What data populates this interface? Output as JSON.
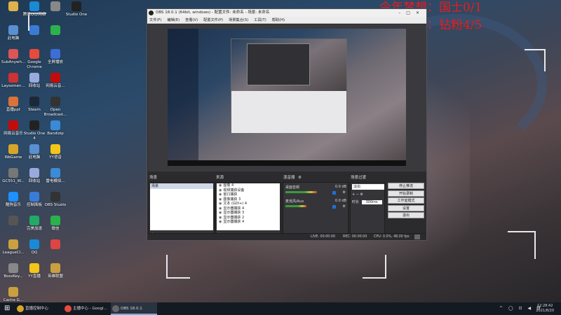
{
  "overlay": {
    "line1": "今年梦想：国士0/1",
    "line2": "今日梦想：钻粉4/5",
    "accent_color": "#e81c1c"
  },
  "desktop_icons": [
    {
      "label": "",
      "icon": "app-icon",
      "color": "#e0b24a"
    },
    {
      "label": "腾讯QQ/网络",
      "icon": "qq-icon",
      "color": "#1a8ad6"
    },
    {
      "label": "",
      "icon": "app-icon",
      "color": "#888"
    },
    {
      "label": "Studio One",
      "icon": "studio-icon",
      "color": "#222"
    },
    {
      "label": "此电脑",
      "icon": "computer-icon",
      "color": "#5a8fd0"
    },
    {
      "label": "",
      "icon": "app-icon",
      "color": "#3a7bd5"
    },
    {
      "label": "",
      "icon": "app-icon",
      "color": "#2bb24c"
    },
    {
      "label": "SubAnywh...",
      "icon": "app-icon",
      "color": "#d55"
    },
    {
      "label": "Google Chrome",
      "icon": "chrome-icon",
      "color": "#e84a3c"
    },
    {
      "label": "全屏播放",
      "icon": "app-icon",
      "color": "#3b6ed6"
    },
    {
      "label": "Laysomen...",
      "icon": "app-icon",
      "color": "#c33"
    },
    {
      "label": "回收站",
      "icon": "recycle-icon",
      "color": "#9ad"
    },
    {
      "label": "网易云音...",
      "icon": "app-icon",
      "color": "#c20c0c"
    },
    {
      "label": "直播ppt",
      "icon": "ppt-icon",
      "color": "#d9733a"
    },
    {
      "label": "Steam",
      "icon": "steam-icon",
      "color": "#1b2838"
    },
    {
      "label": "Open Broadcast...",
      "icon": "obs-icon",
      "color": "#333"
    },
    {
      "label": "网易云音乐",
      "icon": "music-icon",
      "color": "#c20c0c"
    },
    {
      "label": "Studio One 4",
      "icon": "studio-icon",
      "color": "#222"
    },
    {
      "label": "Bandizip",
      "icon": "zip-icon",
      "color": "#3a8ad6"
    },
    {
      "label": "WeGame",
      "icon": "wegame-icon",
      "color": "#d6a52a"
    },
    {
      "label": "此电脑",
      "icon": "computer-icon",
      "color": "#5a8fd0"
    },
    {
      "label": "YY语音",
      "icon": "yy-icon",
      "color": "#f5c518"
    },
    {
      "label": "GC551_W...",
      "icon": "app-icon",
      "color": "#777"
    },
    {
      "label": "回收站",
      "icon": "recycle-icon",
      "color": "#9ad"
    },
    {
      "label": "雷电模拟...",
      "icon": "app-icon",
      "color": "#3b8bd6"
    },
    {
      "label": "酷狗音乐",
      "icon": "kugou-icon",
      "color": "#1e90ff"
    },
    {
      "label": "控制面板",
      "icon": "control-panel-icon",
      "color": "#3a7bd5"
    },
    {
      "label": "OBS Studio",
      "icon": "obs-icon",
      "color": "#333"
    },
    {
      "label": "",
      "icon": "app-icon",
      "color": "#555"
    },
    {
      "label": "完美加速",
      "icon": "app-icon",
      "color": "#2a6"
    },
    {
      "label": "微信",
      "icon": "wechat-icon",
      "color": "#2bb24c"
    },
    {
      "label": "LeagueCl...",
      "icon": "league-icon",
      "color": "#c8a040"
    },
    {
      "label": "QQ",
      "icon": "qq-icon",
      "color": "#1a8ad6"
    },
    {
      "label": "",
      "icon": "app-icon",
      "color": "#d44"
    },
    {
      "label": "BossKey...",
      "icon": "app-icon",
      "color": "#888"
    },
    {
      "label": "YY直播",
      "icon": "yy-icon",
      "color": "#f5c518"
    },
    {
      "label": "英雄联盟",
      "icon": "league-icon",
      "color": "#c8a040"
    },
    {
      "label": "Cache G...",
      "icon": "app-icon",
      "color": "#c8a040"
    }
  ],
  "obs": {
    "title": "OBS 18.0.1 (64bit, windows) - 配置文件: 未命名 - 场景: 未命名",
    "menu": [
      "文件(F)",
      "编辑(E)",
      "查看(V)",
      "配置文件(P)",
      "场景集合(S)",
      "工具(T)",
      "帮助(H)"
    ],
    "docks": {
      "scenes_title": "场景",
      "sources_title": "来源",
      "mixer_title": "混音器",
      "transitions_title": "场景过渡"
    },
    "scenes": [
      "场景"
    ],
    "sources": [
      "图像 4",
      "视频捕获设备",
      "窗口捕获",
      "图像捕获 3",
      "文本 (GDI+) 4",
      "显示器捕获 4",
      "显示器捕获 3",
      "显示器捕获 2",
      "显示器捕获 4"
    ],
    "mixer": [
      {
        "name": "桌面音频",
        "db": "0.0 dB",
        "level": 0.75
      },
      {
        "name": "麦克风/Aux",
        "db": "0.0 dB",
        "level": 0.5
      }
    ],
    "transition": {
      "selected": "淡出",
      "duration_label": "时长",
      "duration_value": "300ms"
    },
    "controls": [
      "停止推流",
      "开始录制",
      "工作室模式",
      "设置",
      "退出"
    ],
    "status": {
      "live": "LIVE: 00:00:00",
      "rec": "REC: 00:00:00",
      "cpu": "CPU: 0.0%, 48.00 fps"
    },
    "dock_footer": "+ − ∧ ∨"
  },
  "taskbar": {
    "items": [
      {
        "label": "直播控制中心",
        "icon": "live-icon",
        "color": "#d6a52a",
        "active": false
      },
      {
        "label": "主播中心 - Googl...",
        "icon": "chrome-icon",
        "color": "#e84a3c",
        "active": false
      },
      {
        "label": "OBS 18.0.1 (64bit...",
        "icon": "obs-icon",
        "color": "#666",
        "active": true
      }
    ],
    "tray": "^ ◯ ⊡ ◀ 拼",
    "time": "12:28:42",
    "date": "2021/8/20"
  }
}
